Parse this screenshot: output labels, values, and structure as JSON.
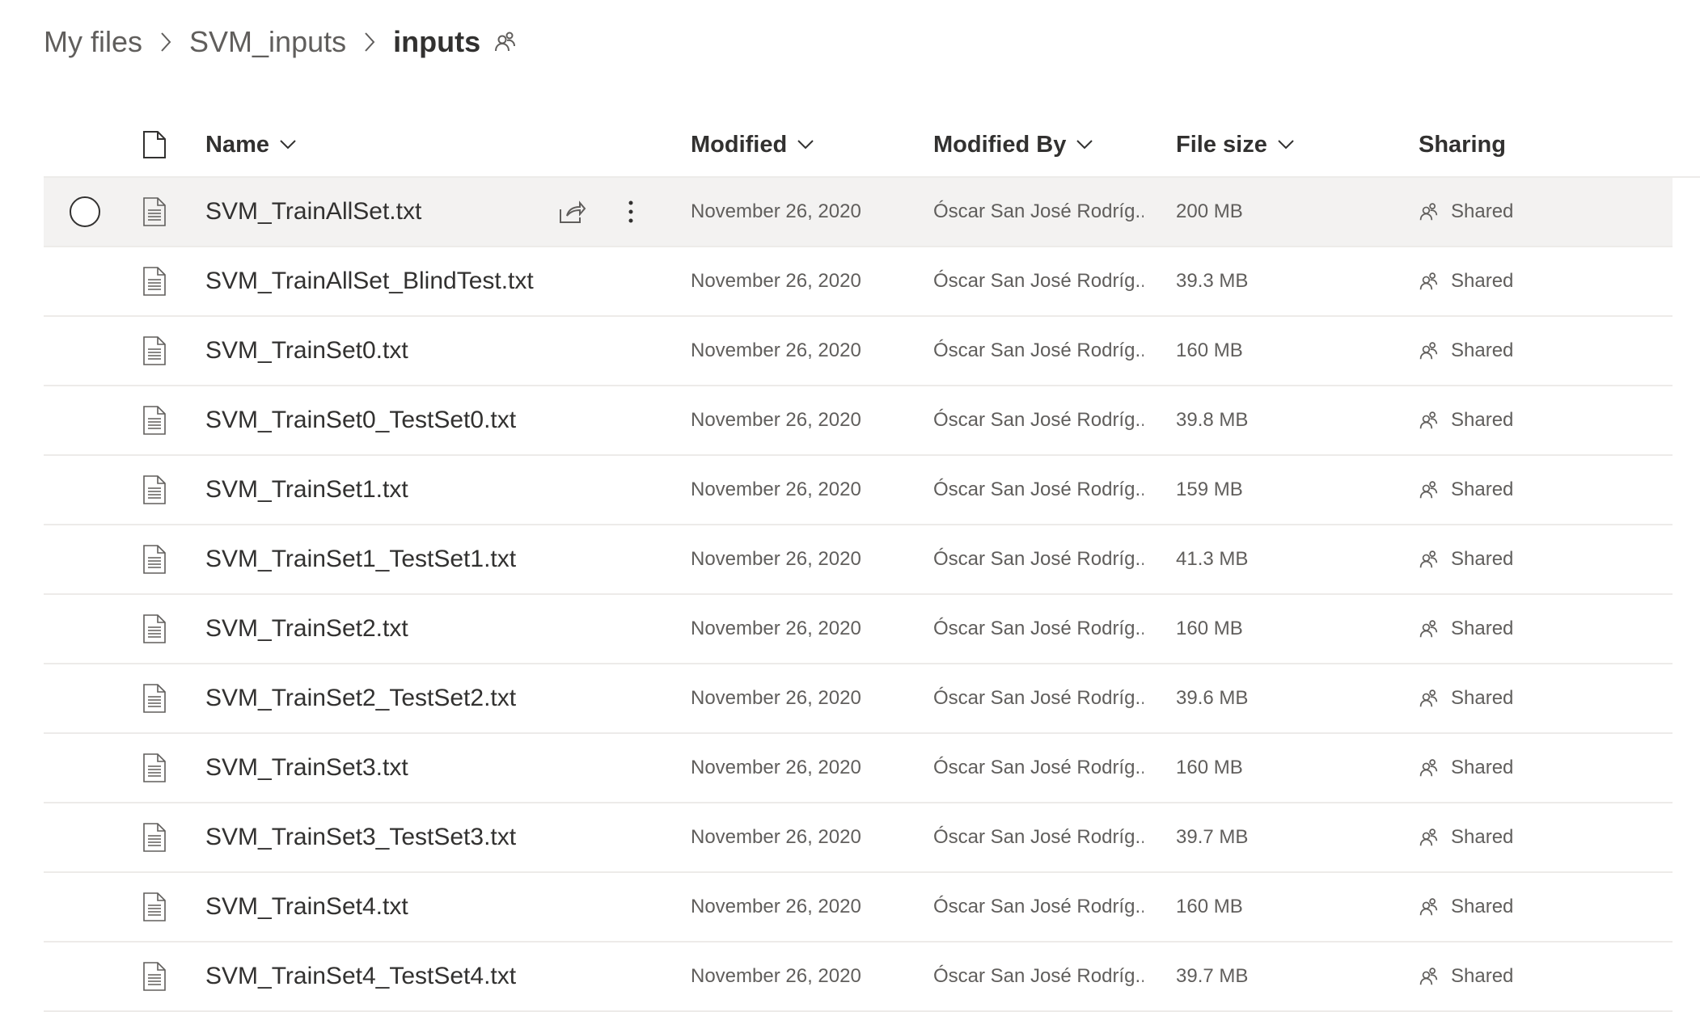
{
  "breadcrumb": {
    "items": [
      "My files",
      "SVM_inputs",
      "inputs"
    ]
  },
  "columns": {
    "name": "Name",
    "modified": "Modified",
    "modified_by": "Modified By",
    "file_size": "File size",
    "sharing": "Sharing"
  },
  "files": [
    {
      "name": "SVM_TrainAllSet.txt",
      "modified": "November 26, 2020",
      "modified_by": "Óscar San José Rodríg...",
      "size": "200 MB",
      "sharing": "Shared",
      "selected": true
    },
    {
      "name": "SVM_TrainAllSet_BlindTest.txt",
      "modified": "November 26, 2020",
      "modified_by": "Óscar San José Rodríg...",
      "size": "39.3 MB",
      "sharing": "Shared"
    },
    {
      "name": "SVM_TrainSet0.txt",
      "modified": "November 26, 2020",
      "modified_by": "Óscar San José Rodríg...",
      "size": "160 MB",
      "sharing": "Shared"
    },
    {
      "name": "SVM_TrainSet0_TestSet0.txt",
      "modified": "November 26, 2020",
      "modified_by": "Óscar San José Rodríg...",
      "size": "39.8 MB",
      "sharing": "Shared"
    },
    {
      "name": "SVM_TrainSet1.txt",
      "modified": "November 26, 2020",
      "modified_by": "Óscar San José Rodríg...",
      "size": "159 MB",
      "sharing": "Shared"
    },
    {
      "name": "SVM_TrainSet1_TestSet1.txt",
      "modified": "November 26, 2020",
      "modified_by": "Óscar San José Rodríg...",
      "size": "41.3 MB",
      "sharing": "Shared"
    },
    {
      "name": "SVM_TrainSet2.txt",
      "modified": "November 26, 2020",
      "modified_by": "Óscar San José Rodríg...",
      "size": "160 MB",
      "sharing": "Shared"
    },
    {
      "name": "SVM_TrainSet2_TestSet2.txt",
      "modified": "November 26, 2020",
      "modified_by": "Óscar San José Rodríg...",
      "size": "39.6 MB",
      "sharing": "Shared"
    },
    {
      "name": "SVM_TrainSet3.txt",
      "modified": "November 26, 2020",
      "modified_by": "Óscar San José Rodríg...",
      "size": "160 MB",
      "sharing": "Shared"
    },
    {
      "name": "SVM_TrainSet3_TestSet3.txt",
      "modified": "November 26, 2020",
      "modified_by": "Óscar San José Rodríg...",
      "size": "39.7 MB",
      "sharing": "Shared"
    },
    {
      "name": "SVM_TrainSet4.txt",
      "modified": "November 26, 2020",
      "modified_by": "Óscar San José Rodríg...",
      "size": "160 MB",
      "sharing": "Shared"
    },
    {
      "name": "SVM_TrainSet4_TestSet4.txt",
      "modified": "November 26, 2020",
      "modified_by": "Óscar San José Rodríg...",
      "size": "39.7 MB",
      "sharing": "Shared"
    }
  ],
  "colors": {
    "text_primary": "#323130",
    "text_secondary": "#605e5c",
    "row_selected": "#f3f2f1",
    "divider": "#edebe9"
  }
}
